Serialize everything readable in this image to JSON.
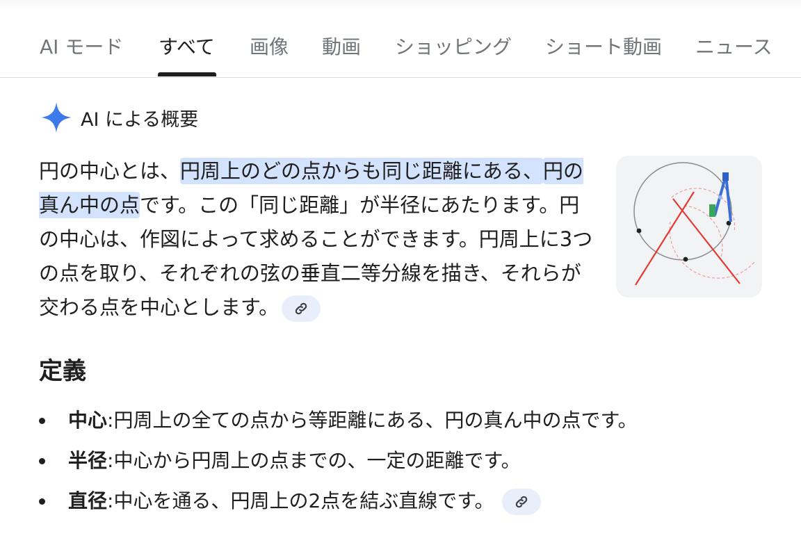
{
  "tabs": [
    {
      "label": "AI モード",
      "active": false
    },
    {
      "label": "すべて",
      "active": true
    },
    {
      "label": "画像",
      "active": false
    },
    {
      "label": "動画",
      "active": false
    },
    {
      "label": "ショッピング",
      "active": false
    },
    {
      "label": "ショート動画",
      "active": false
    },
    {
      "label": "ニュース",
      "active": false
    }
  ],
  "overview": {
    "icon": "sparkle-icon",
    "title": "AI による概要"
  },
  "summary": {
    "part1": "円の中心とは、",
    "highlight1": "円周上のどの点からも同じ距離にある、",
    "highlight2": "円の真ん中の点",
    "part2": "です。この「同じ距離」が半径にあたります。円の中心は、作図によって求めることができます。円周上に3つの点を取り、それぞれの弦の垂直二等分線を描き、それらが交わる点を中心とします。",
    "link_icon": "link-icon"
  },
  "thumbnail": {
    "subject": "compass-circle-construction-image",
    "colors": {
      "circle": "#7a7a7a",
      "lines": "#e53935",
      "arcs": "#ef9a9a",
      "compass": "#3a6fd8"
    }
  },
  "definitions": {
    "title": "定義",
    "items": [
      {
        "term": "中心",
        "text": ":円周上の全ての点から等距離にある、円の真ん中の点です。",
        "has_link": false
      },
      {
        "term": "半径",
        "text": ":中心から円周上の点までの、一定の距離です。",
        "has_link": false
      },
      {
        "term": "直径",
        "text": ":中心を通る、円周上の2点を結ぶ直線です。",
        "has_link": true
      }
    ]
  },
  "colors": {
    "highlight": "#d3e3fd",
    "link_chip": "#e8effb",
    "sparkle": "#4285f4",
    "tab_inactive": "#70757a",
    "text": "#1f1f1f"
  }
}
